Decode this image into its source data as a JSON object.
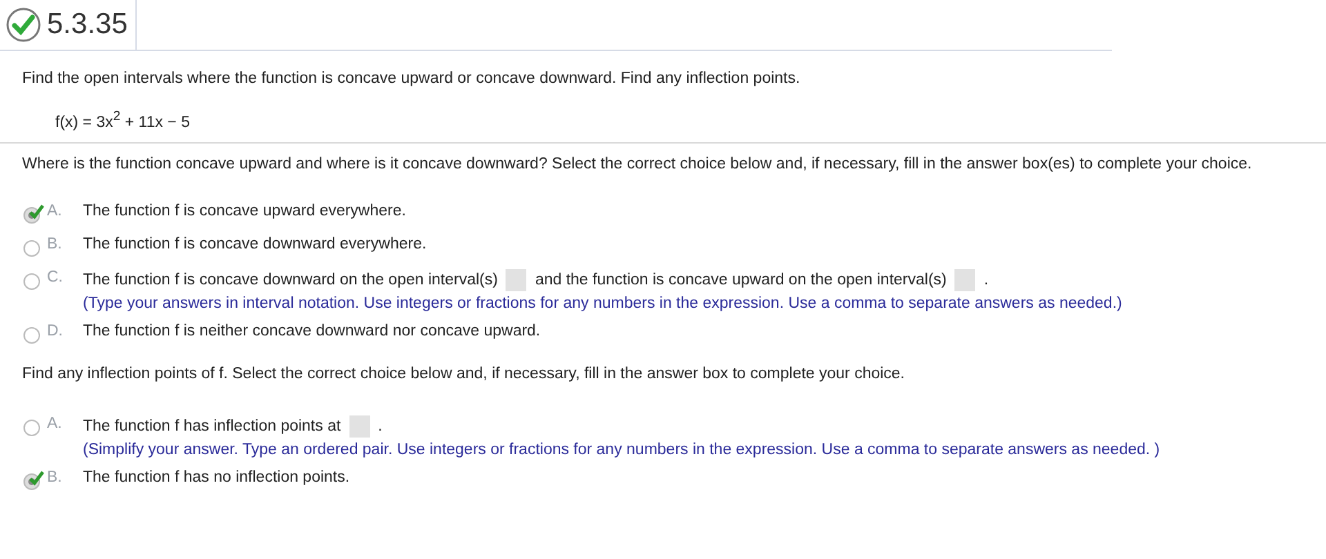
{
  "header": {
    "number": "5.3.35",
    "correct": true
  },
  "instructions": "Find the open intervals where the function is concave upward or concave downward. Find any inflection points.",
  "formula": "f(x) = 3x$^{2}$ + 11x − 5",
  "questions": [
    {
      "prompt": "Where is the function concave upward and where is it concave downward? Select the correct choice below and, if necessary, fill in the answer box(es) to complete your choice.",
      "choices": [
        {
          "letter": "A.",
          "selected": true,
          "parts": [
            {
              "kind": "text",
              "text": "The function f is concave upward everywhere."
            }
          ]
        },
        {
          "letter": "B.",
          "selected": false,
          "parts": [
            {
              "kind": "text",
              "text": "The function f is concave downward everywhere."
            }
          ]
        },
        {
          "letter": "C.",
          "selected": false,
          "parts": [
            {
              "kind": "text",
              "text": "The function f is concave downward on the open interval(s)"
            },
            {
              "kind": "blank"
            },
            {
              "kind": "text",
              "text": "and the function is concave upward on the open interval(s)"
            },
            {
              "kind": "blank"
            },
            {
              "kind": "text",
              "text": "."
            }
          ],
          "hint": "(Type your answers in interval notation. Use integers or fractions for any numbers in the expression. Use a comma to separate answers as needed.)"
        },
        {
          "letter": "D.",
          "selected": false,
          "parts": [
            {
              "kind": "text",
              "text": "The function f is neither concave downward nor concave upward."
            }
          ]
        }
      ]
    },
    {
      "prompt": "Find any inflection points of f. Select the correct choice below and, if necessary, fill in the answer box to complete your choice.",
      "choices": [
        {
          "letter": "A.",
          "selected": false,
          "parts": [
            {
              "kind": "text",
              "text": "The function f has inflection points at"
            },
            {
              "kind": "blank"
            },
            {
              "kind": "text",
              "text": "."
            }
          ],
          "hint": "(Simplify your answer. Type an ordered pair. Use integers or fractions for any numbers in the expression. Use a comma to separate answers as needed. )"
        },
        {
          "letter": "B.",
          "selected": true,
          "parts": [
            {
              "kind": "text",
              "text": "The function f has no inflection points."
            }
          ]
        }
      ]
    }
  ]
}
